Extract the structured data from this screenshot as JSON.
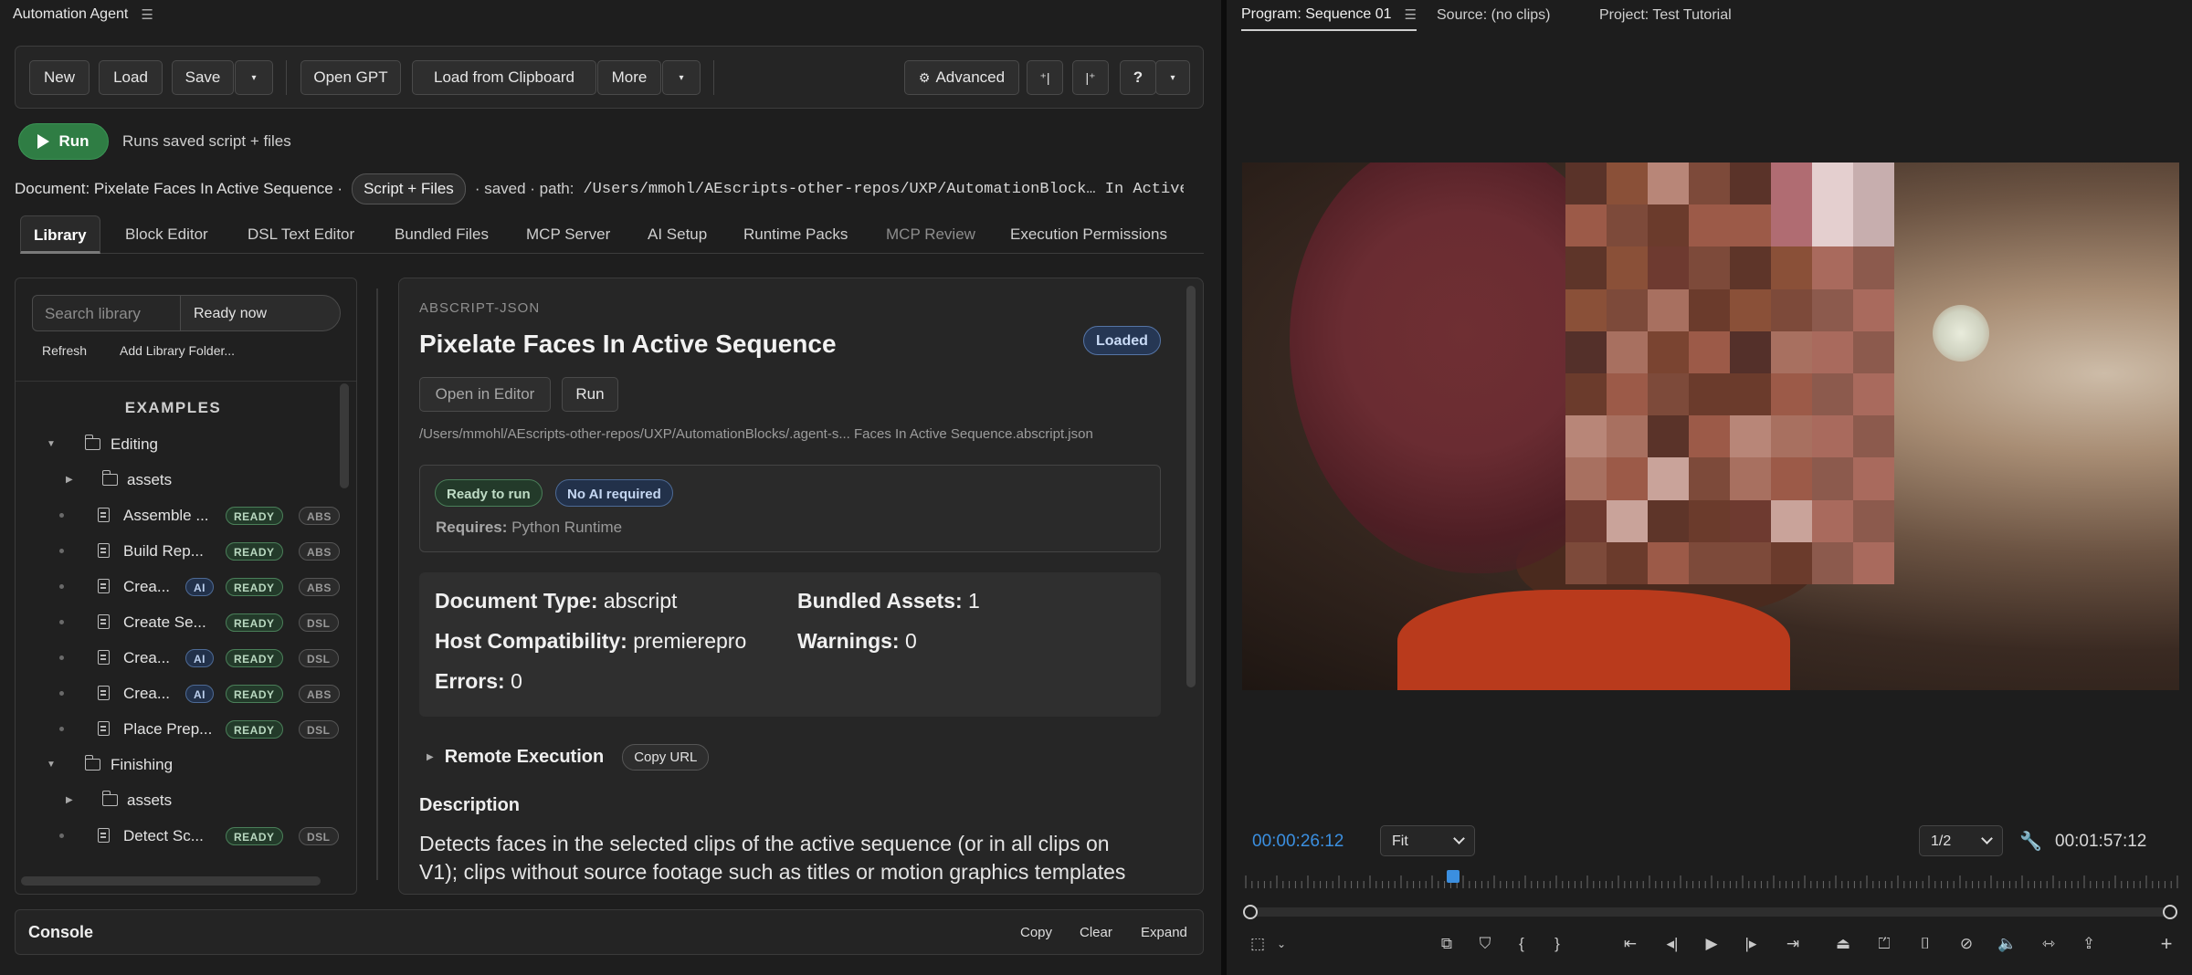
{
  "left_panel": {
    "title": "Automation Agent",
    "toolbar": {
      "new": "New",
      "load": "Load",
      "save": "Save",
      "open_gpt": "Open GPT",
      "load_clipboard": "Load from Clipboard",
      "more": "More",
      "advanced": "Advanced",
      "help": "?"
    },
    "run": {
      "label": "Run",
      "description": "Runs saved script + files"
    },
    "doc_line": {
      "document": "Document: Pixelate Faces In Active Sequence ·",
      "mode": "Script + Files",
      "status": "· saved · path:",
      "path": "/Users/mmohl/AEscripts-other-repos/UXP/AutomationBlock… In Active…"
    },
    "tabs": [
      "Library",
      "Block Editor",
      "DSL Text Editor",
      "Bundled Files",
      "MCP Server",
      "AI Setup",
      "Runtime Packs",
      "MCP Review",
      "Execution Permissions"
    ],
    "library": {
      "search_placeholder": "Search library",
      "filter": "Ready now",
      "refresh": "Refresh",
      "add_folder": "Add Library Folder...",
      "section": "EXAMPLES",
      "tree": [
        {
          "label": "Editing"
        },
        {
          "label": "assets"
        },
        {
          "label": "Assemble ...",
          "ai": "",
          "ready": "READY",
          "type": "ABS"
        },
        {
          "label": "Build Rep...",
          "ai": "",
          "ready": "READY",
          "type": "ABS"
        },
        {
          "label": "Crea...",
          "ai": "AI",
          "ready": "READY",
          "type": "ABS"
        },
        {
          "label": "Create Se...",
          "ai": "",
          "ready": "READY",
          "type": "DSL"
        },
        {
          "label": "Crea...",
          "ai": "AI",
          "ready": "READY",
          "type": "DSL"
        },
        {
          "label": "Crea...",
          "ai": "AI",
          "ready": "READY",
          "type": "ABS"
        },
        {
          "label": "Place Prep...",
          "ai": "",
          "ready": "READY",
          "type": "DSL"
        },
        {
          "label": "Finishing"
        },
        {
          "label": "assets"
        },
        {
          "label": "Detect Sc...",
          "ai": "",
          "ready": "READY",
          "type": "DSL"
        }
      ]
    },
    "detail": {
      "kind": "ABSCRIPT-JSON",
      "title": "Pixelate Faces In Active Sequence",
      "loaded": "Loaded",
      "open_editor": "Open in Editor",
      "run": "Run",
      "path": "/Users/mmohl/AEscripts-other-repos/UXP/AutomationBlocks/.agent-s... Faces In Active Sequence.abscript.json",
      "tag_ready": "Ready to run",
      "tag_noai": "No AI required",
      "requires_label": "Requires:",
      "requires_value": "Python Runtime",
      "doc_type_label": "Document Type:",
      "doc_type_value": "abscript",
      "assets_label": "Bundled Assets:",
      "assets_value": "1",
      "host_label": "Host Compatibility:",
      "host_value": "premierepro",
      "warnings_label": "Warnings:",
      "warnings_value": "0",
      "errors_label": "Errors:",
      "errors_value": "0",
      "remote": "Remote Execution",
      "copy_url": "Copy URL",
      "desc_heading": "Description",
      "description": "Detects faces in the selected clips of the active sequence (or in all clips on V1); clips without source footage such as titles or motion graphics templates are"
    },
    "console": {
      "label": "Console",
      "copy": "Copy",
      "clear": "Clear",
      "expand": "Expand"
    }
  },
  "right_panel": {
    "tabs": {
      "program": "Program: Sequence 01",
      "source": "Source: (no clips)",
      "project": "Project: Test Tutorial"
    },
    "timecode_current": "00:00:26:12",
    "zoom": "Fit",
    "resolution": "1/2",
    "timecode_duration": "00:01:57:12",
    "playhead_position_fraction": 0.225,
    "accent": "#3b8fe0"
  }
}
